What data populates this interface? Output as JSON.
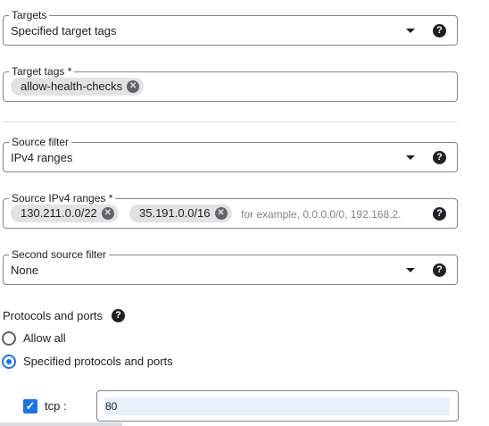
{
  "targets": {
    "label": "Targets",
    "value": "Specified target tags"
  },
  "target_tags": {
    "label": "Target tags *",
    "chips": [
      "allow-health-checks"
    ]
  },
  "source_filter": {
    "label": "Source filter",
    "value": "IPv4 ranges"
  },
  "source_ranges": {
    "label": "Source IPv4 ranges *",
    "chips": [
      "130.211.0.0/22",
      "35.191.0.0/16"
    ],
    "placeholder": "for example, 0.0.0.0/0, 192.168.2."
  },
  "second_source_filter": {
    "label": "Second source filter",
    "value": "None"
  },
  "protocols": {
    "title": "Protocols and ports",
    "options": [
      "Allow all",
      "Specified protocols and ports"
    ],
    "selected": "Specified protocols and ports",
    "tcp_label": "tcp :",
    "tcp_checked": true,
    "tcp_ports": "80"
  },
  "icons": {
    "help": "help-icon",
    "dropdown": "chevron-down-icon",
    "remove": "cancel-icon",
    "check": "check-icon"
  },
  "colors": {
    "accent": "#1a73e8",
    "border": "#80868b",
    "chip": "#e2e2e2",
    "input_highlight": "#e8f0fe"
  }
}
